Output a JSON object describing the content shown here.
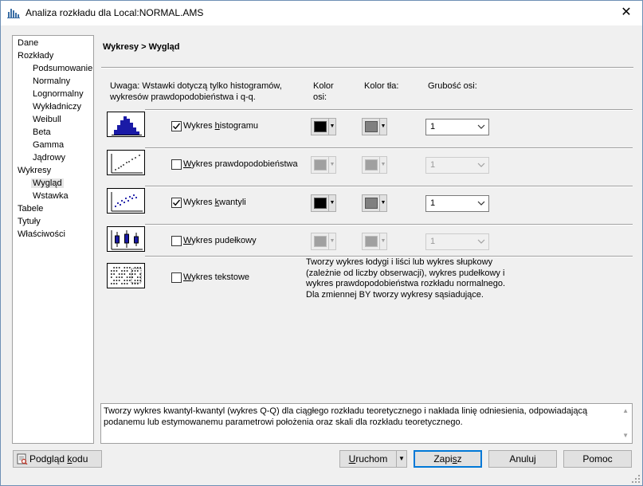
{
  "window": {
    "title": "Analiza rozkładu dla Local:NORMAL.AMS",
    "close_symbol": "✕"
  },
  "nav": {
    "items": [
      {
        "label": "Dane",
        "indent": 0
      },
      {
        "label": "Rozkłady",
        "indent": 0
      },
      {
        "label": "Podsumowanie",
        "indent": 1
      },
      {
        "label": "Normalny",
        "indent": 1
      },
      {
        "label": "Lognormalny",
        "indent": 1
      },
      {
        "label": "Wykładniczy",
        "indent": 1
      },
      {
        "label": "Weibull",
        "indent": 1
      },
      {
        "label": "Beta",
        "indent": 1
      },
      {
        "label": "Gamma",
        "indent": 1
      },
      {
        "label": "Jądrowy",
        "indent": 1
      },
      {
        "label": "Wykresy",
        "indent": 0
      },
      {
        "label": "Wygląd",
        "indent": 1,
        "selected": true
      },
      {
        "label": "Wstawka",
        "indent": 1
      },
      {
        "label": "Tabele",
        "indent": 0
      },
      {
        "label": "Tytuły",
        "indent": 0
      },
      {
        "label": "Właściwości",
        "indent": 0
      }
    ]
  },
  "panel": {
    "title": "Wykresy > Wygląd",
    "note": "Uwaga: Wstawki dotyczą tylko histogramów, wykresów prawdopodobieństwa i q-q.",
    "col_axis_color": "Kolor osi:",
    "col_bg_color": "Kolor tła:",
    "col_axis_thickness": "Grubość osi:"
  },
  "plots": [
    {
      "icon": "histogram-plot-icon",
      "checked": true,
      "label_pre": "Wykres ",
      "label_u": "h",
      "label_post": "istogramu",
      "axis_color": "#000000",
      "bg_color": "#808080",
      "thickness": "1",
      "enabled": true
    },
    {
      "icon": "probability-plot-icon",
      "checked": false,
      "label_pre": "",
      "label_u": "W",
      "label_post": "ykres prawdopodobieństwa",
      "axis_color": "#a0a0a0",
      "bg_color": "#a0a0a0",
      "thickness": "1",
      "enabled": false
    },
    {
      "icon": "quantile-plot-icon",
      "checked": true,
      "label_pre": "Wykres ",
      "label_u": "k",
      "label_post": "wantyli",
      "axis_color": "#000000",
      "bg_color": "#808080",
      "thickness": "1",
      "enabled": true
    },
    {
      "icon": "box-plot-icon",
      "checked": false,
      "label_pre": "",
      "label_u": "W",
      "label_post": "ykres pudełkowy",
      "axis_color": "#a0a0a0",
      "bg_color": "#a0a0a0",
      "thickness": "1",
      "enabled": false
    },
    {
      "icon": "text-plot-icon",
      "checked": false,
      "label_pre": "",
      "label_u": "W",
      "label_post": "ykres tekstowe"
    }
  ],
  "text_plot_description": "Tworzy wykres łodygi i liści lub wykres słupkowy (zależnie od liczby obserwacji), wykres pudełkowy i wykres prawdopodobieństwa rozkładu normalnego. Dla zmiennej BY tworzy wykresy sąsiadujące.",
  "help_text": "Tworzy wykres kwantyl-kwantyl (wykres Q-Q) dla ciągłego rozkładu teoretycznego i nakłada linię odniesienia, odpowiadającą podanemu lub estymowanemu parametrowi położenia oraz skali dla rozkładu teoretycznego.",
  "buttons": {
    "preview_pre": "Podgląd ",
    "preview_u": "k",
    "preview_post": "odu",
    "run_pre": "",
    "run_u": "U",
    "run_post": "ruchom",
    "save_pre": "Zapi",
    "save_u": "s",
    "save_post": "z",
    "cancel": "Anuluj",
    "help": "Pomoc"
  }
}
